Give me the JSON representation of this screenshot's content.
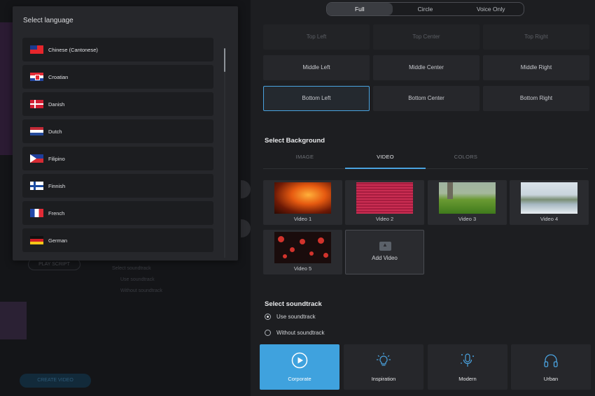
{
  "language_modal": {
    "title": "Select language",
    "languages": [
      {
        "name": "Chinese (Cantonese)",
        "flag": "taiwan-flag"
      },
      {
        "name": "Croatian",
        "flag": "croatia-flag"
      },
      {
        "name": "Danish",
        "flag": "denmark-flag"
      },
      {
        "name": "Dutch",
        "flag": "netherlands-flag"
      },
      {
        "name": "Filipino",
        "flag": "philippines-flag"
      },
      {
        "name": "Finnish",
        "flag": "finland-flag"
      },
      {
        "name": "French",
        "flag": "france-flag"
      },
      {
        "name": "German",
        "flag": "germany-flag"
      }
    ]
  },
  "background_page": {
    "play_script": "PLAY SCRIPT",
    "select_soundtrack": "Select soundtrack",
    "use_soundtrack": "Use soundtrack",
    "without_soundtrack": "Without soundtrack",
    "create_video": "CREATE VIDEO"
  },
  "mode": {
    "options": [
      "Full",
      "Circle",
      "Voice Only"
    ],
    "selected": "Full"
  },
  "position": {
    "cells": [
      "Top Left",
      "Top Center",
      "Top Right",
      "Middle Left",
      "Middle Center",
      "Middle Right",
      "Bottom Left",
      "Bottom Center",
      "Bottom Right"
    ],
    "selected": "Bottom Left"
  },
  "background": {
    "title": "Select Background",
    "tabs": [
      "IMAGE",
      "VIDEO",
      "COLORS"
    ],
    "active_tab": "VIDEO",
    "videos": [
      "Video 1",
      "Video 2",
      "Video 3",
      "Video 4",
      "Video 5"
    ],
    "add_video_label": "Add Video"
  },
  "soundtrack": {
    "title": "Select soundtrack",
    "options": [
      "Use soundtrack",
      "Without soundtrack"
    ],
    "selected": "Use soundtrack",
    "tracks": [
      {
        "label": "Corporate",
        "icon": "play-circle-icon"
      },
      {
        "label": "Inspiration",
        "icon": "lightbulb-icon"
      },
      {
        "label": "Modern",
        "icon": "microphone-icon"
      },
      {
        "label": "Urban",
        "icon": "headphones-icon"
      }
    ],
    "selected_track": "Corporate"
  },
  "colors": {
    "accent": "#4aa3e0",
    "active_track": "#3fa2de"
  }
}
